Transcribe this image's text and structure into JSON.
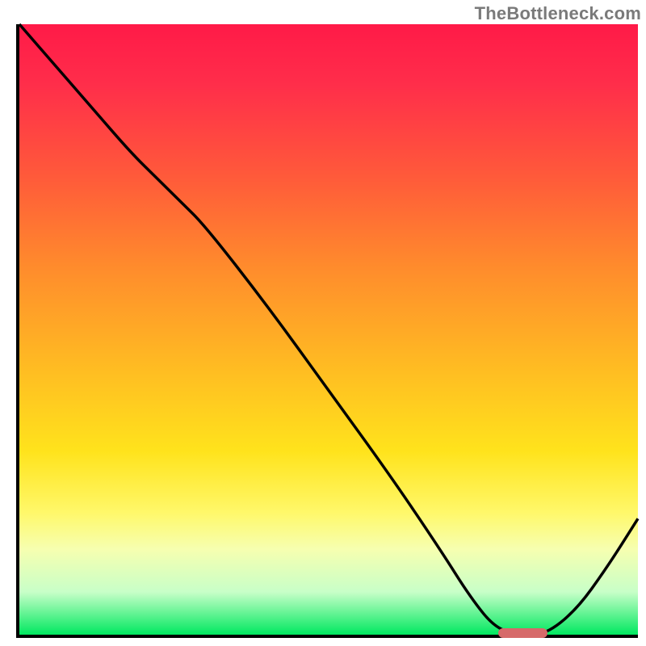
{
  "attribution": "TheBottleneck.com",
  "chart_data": {
    "type": "line",
    "title": "",
    "xlabel": "",
    "ylabel": "",
    "xlim": [
      0,
      100
    ],
    "ylim": [
      0,
      100
    ],
    "grid": false,
    "series": [
      {
        "name": "bottleneck-curve",
        "x": [
          0,
          6,
          12,
          18,
          22,
          26,
          30,
          40,
          50,
          60,
          68,
          73,
          77,
          81,
          85,
          90,
          95,
          100
        ],
        "y": [
          100,
          93,
          86,
          79,
          75,
          71,
          67,
          54,
          40,
          26,
          14,
          6,
          1,
          0,
          0,
          4,
          11,
          19
        ],
        "note": "y is percent of plot height from bottom; curve descends from top-left, small knee around x≈22-26, reaches minimum flat segment ≈ x 77–85, then rises to right edge"
      }
    ],
    "markers": [
      {
        "name": "optimal-range",
        "x_start": 77,
        "x_end": 85,
        "y": 0.8,
        "color": "#d66a6a"
      }
    ],
    "gradient_stops": [
      {
        "pos": 0,
        "color": "#ff1a48"
      },
      {
        "pos": 25,
        "color": "#ff5a3a"
      },
      {
        "pos": 55,
        "color": "#ffb823"
      },
      {
        "pos": 80,
        "color": "#fff86a"
      },
      {
        "pos": 93,
        "color": "#c8ffc8"
      },
      {
        "pos": 100,
        "color": "#00e860"
      }
    ]
  }
}
